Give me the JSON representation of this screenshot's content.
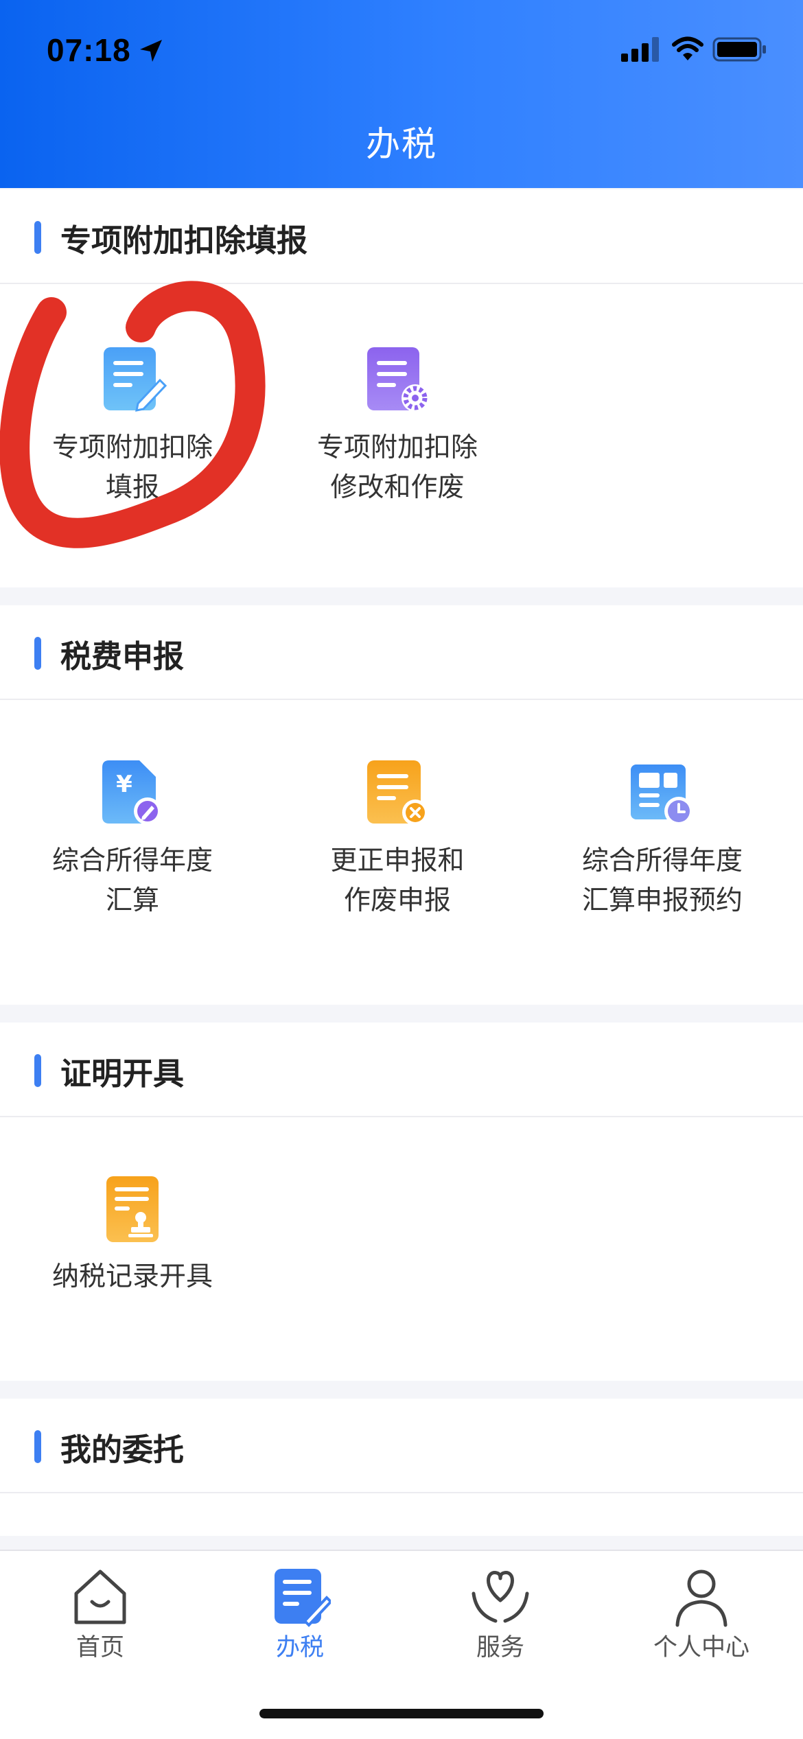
{
  "status_bar": {
    "time": "07:18"
  },
  "header": {
    "title": "办税"
  },
  "sections": [
    {
      "title": "专项附加扣除填报",
      "items": [
        {
          "label": "专项附加扣除\n填报",
          "icon": "doc-edit-icon"
        },
        {
          "label": "专项附加扣除\n修改和作废",
          "icon": "doc-gear-icon"
        }
      ]
    },
    {
      "title": "税费申报",
      "items": [
        {
          "label": "综合所得年度\n汇算",
          "icon": "yen-doc-icon"
        },
        {
          "label": "更正申报和\n作废申报",
          "icon": "doc-cancel-icon"
        },
        {
          "label": "综合所得年度\n汇算申报预约",
          "icon": "calendar-clock-icon"
        }
      ]
    },
    {
      "title": "证明开具",
      "items": [
        {
          "label": "纳税记录开具",
          "icon": "doc-stamp-icon"
        }
      ]
    },
    {
      "title": "我的委托",
      "items": []
    }
  ],
  "tabbar": {
    "tabs": [
      {
        "label": "首页",
        "icon": "home-icon",
        "active": false
      },
      {
        "label": "办税",
        "icon": "tax-doc-icon",
        "active": true
      },
      {
        "label": "服务",
        "icon": "heart-hands-icon",
        "active": false
      },
      {
        "label": "个人中心",
        "icon": "person-icon",
        "active": false
      }
    ]
  },
  "colors": {
    "accent": "#3d7ff2",
    "header_gradient_start": "#0a63f0",
    "header_gradient_end": "#4a8fff",
    "annotation": "#e0261a"
  }
}
